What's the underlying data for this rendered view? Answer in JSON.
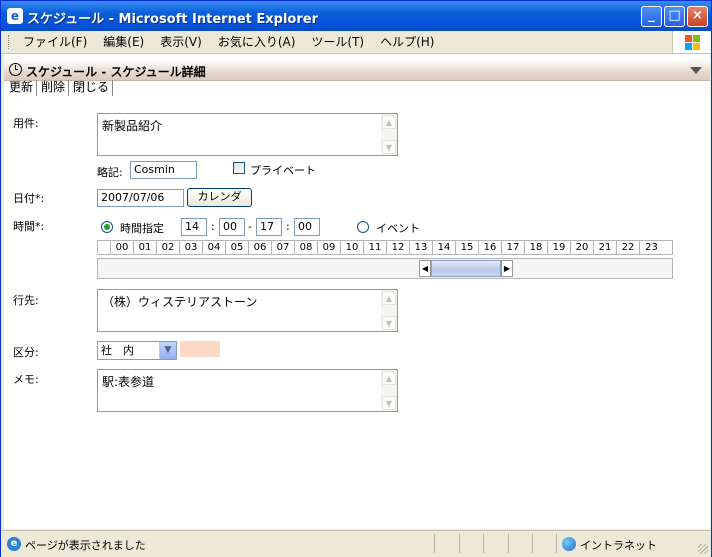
{
  "window": {
    "title": "スケジュール - Microsoft Internet Explorer"
  },
  "menu": [
    "ファイル(F)",
    "編集(E)",
    "表示(V)",
    "お気に入り(A)",
    "ツール(T)",
    "ヘルプ(H)"
  ],
  "page": {
    "title": "スケジュール - スケジュール詳細",
    "toolbar": [
      "更新",
      "削除",
      "閉じる"
    ]
  },
  "form": {
    "subject": {
      "label": "用件:",
      "value": "新製品紹介"
    },
    "abbrev": {
      "label": "略記:",
      "value": "Cosmin"
    },
    "private": {
      "label": "プライベート",
      "checked": false
    },
    "date": {
      "label": "日付*:",
      "value": "2007/07/06",
      "calendar_button": "カレンダ"
    },
    "time": {
      "label": "時間*:",
      "mode_timed_label": "時間指定",
      "start_hour": "14",
      "start_min": "00",
      "dash": "-",
      "end_hour": "17",
      "end_min": "00",
      "colon": ":",
      "event_label": "イベント",
      "selected_mode": "時間指定",
      "hours": [
        "00",
        "01",
        "02",
        "03",
        "04",
        "05",
        "06",
        "07",
        "08",
        "09",
        "10",
        "11",
        "12",
        "13",
        "14",
        "15",
        "16",
        "17",
        "18",
        "19",
        "20",
        "21",
        "22",
        "23"
      ]
    },
    "destination": {
      "label": "行先:",
      "value": "（株）ウィステリアストーン"
    },
    "category": {
      "label": "区分:",
      "value": "社　内",
      "color": "#ffd9c8"
    },
    "memo": {
      "label": "メモ:",
      "value": "駅:表参道"
    }
  },
  "status": {
    "text": "ページが表示されました",
    "zone": "イントラネット"
  }
}
